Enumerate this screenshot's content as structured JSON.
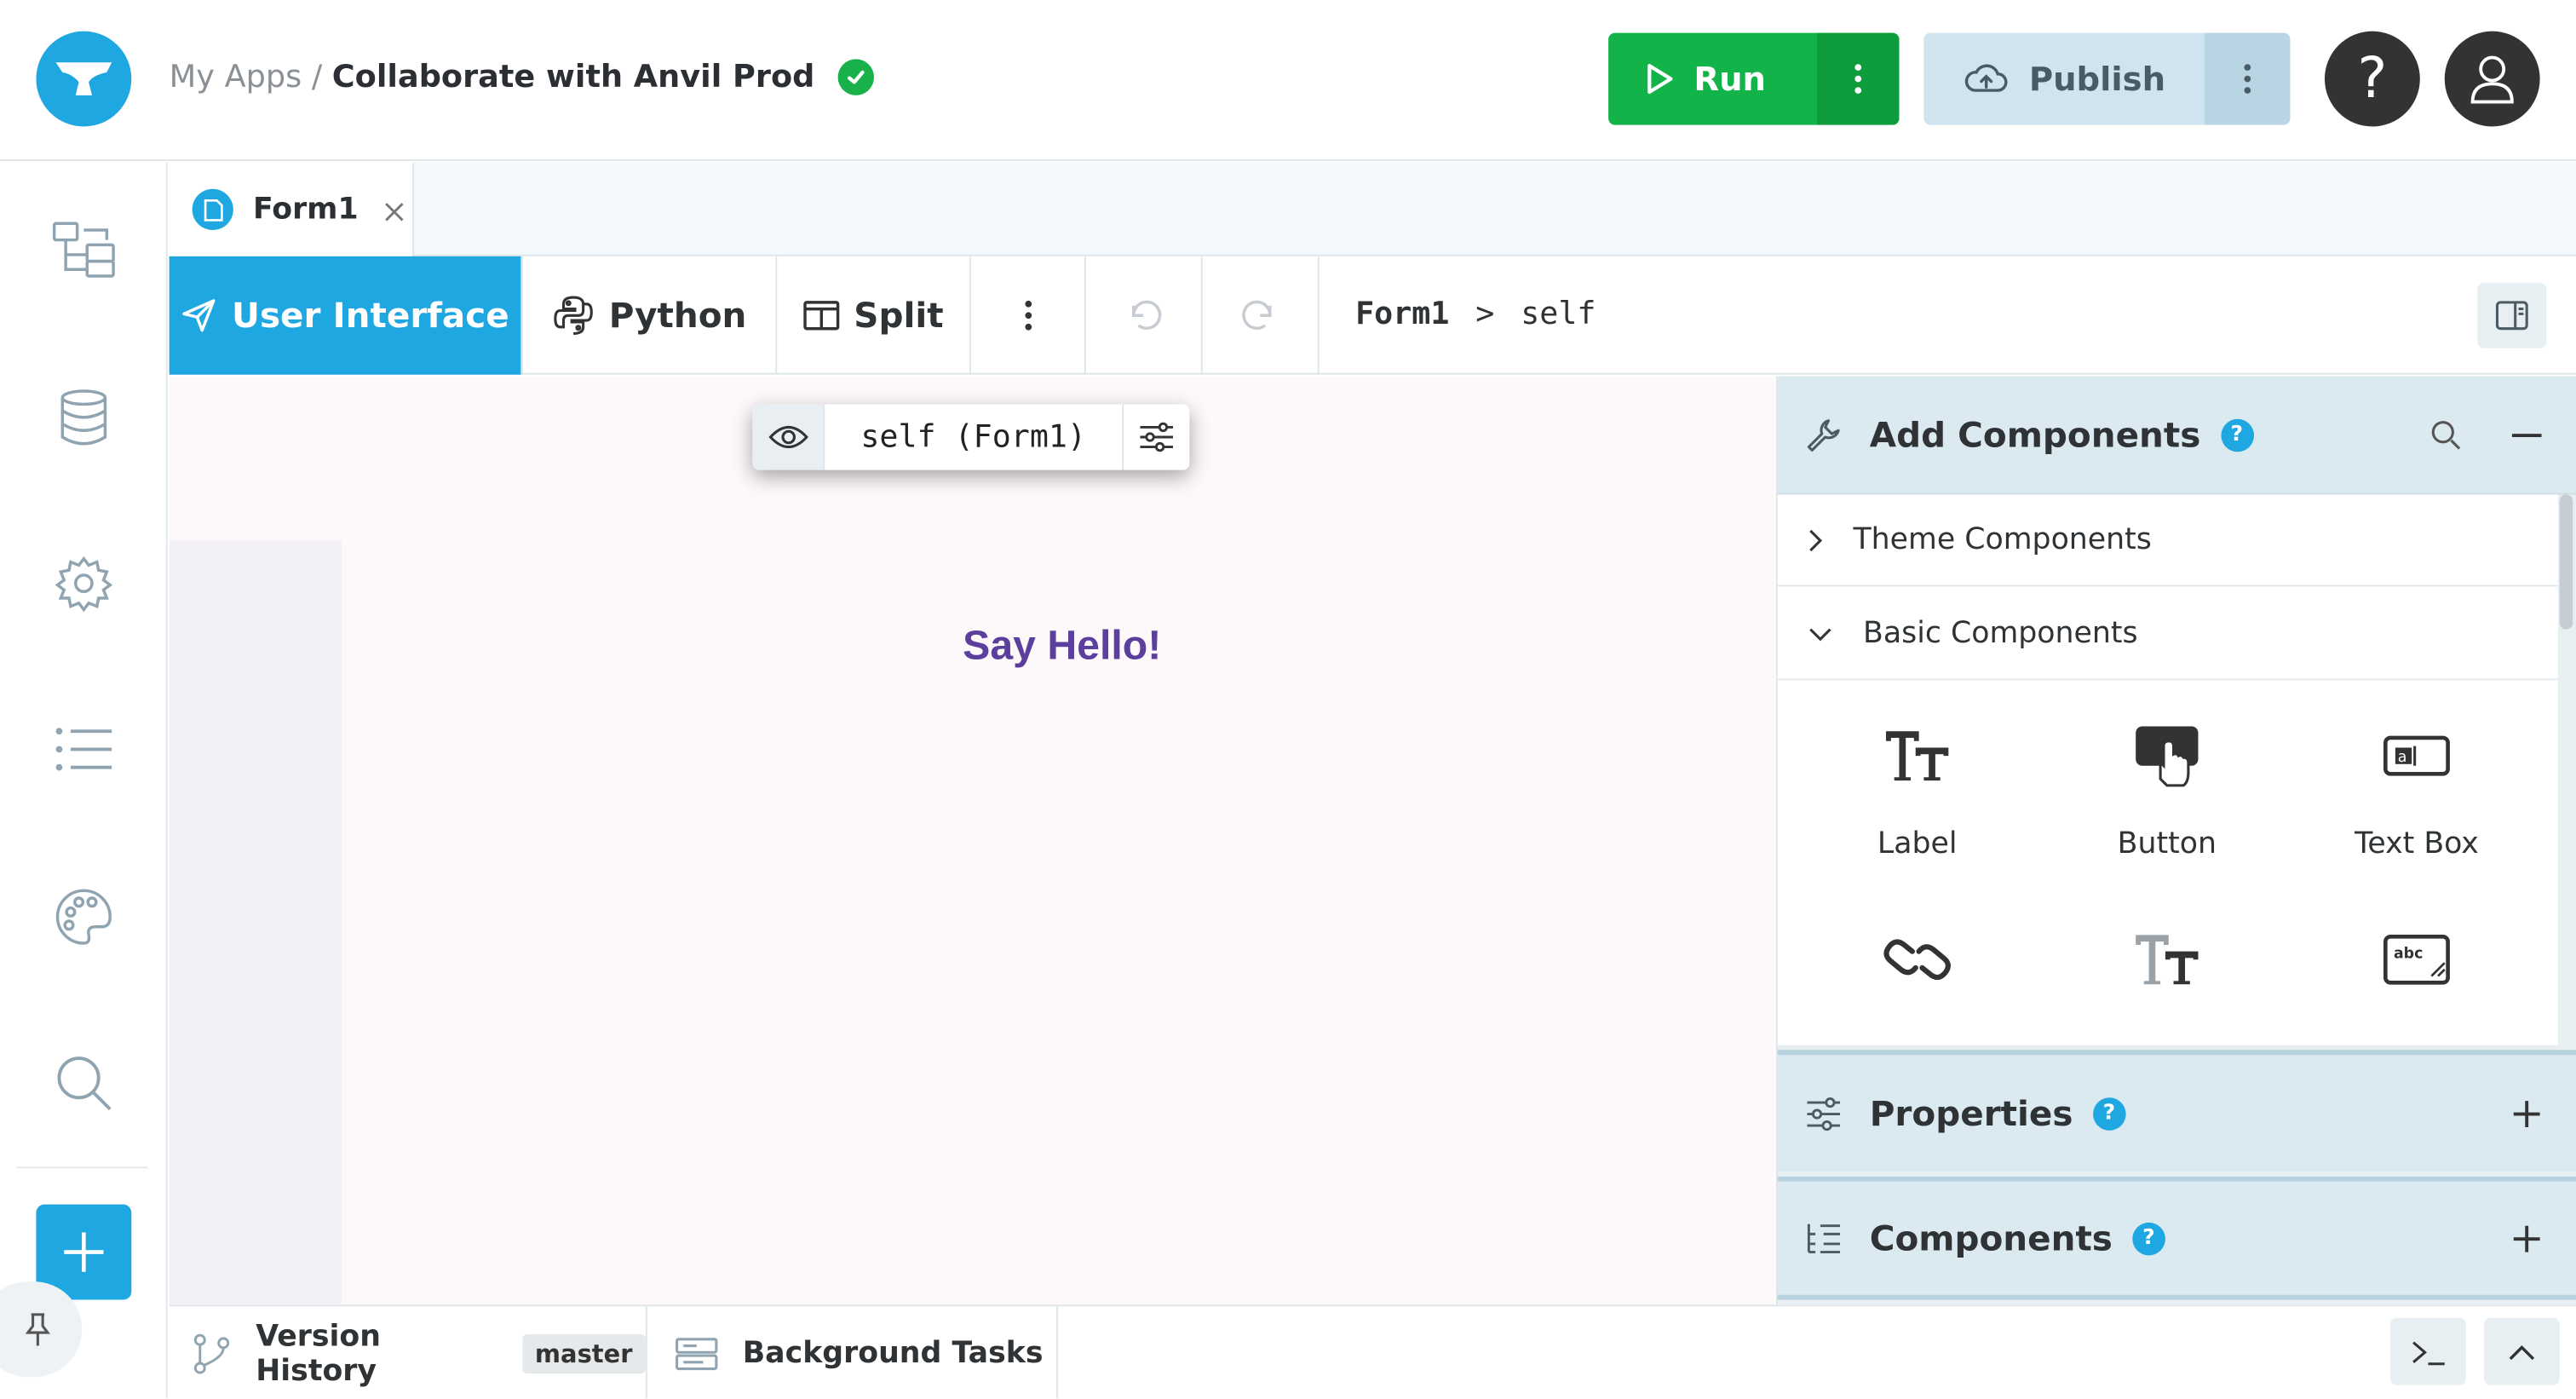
{
  "header": {
    "breadcrumb_root": "My Apps",
    "breadcrumb_sep": "/",
    "app_name": "Collaborate with Anvil Prod",
    "run_label": "Run",
    "publish_label": "Publish",
    "help_glyph": "?"
  },
  "tabs": [
    {
      "label": "Form1"
    }
  ],
  "toolbar": {
    "ui_label": "User Interface",
    "python_label": "Python",
    "split_label": "Split",
    "path_form": "Form1",
    "path_sep": ">",
    "path_self": "self"
  },
  "canvas": {
    "chip_label": "self (Form1)",
    "hello_text": "Say Hello!"
  },
  "panel": {
    "add_title": "Add Components",
    "theme_section": "Theme Components",
    "basic_section": "Basic Components",
    "components": [
      {
        "label": "Label",
        "icon": "label-icon"
      },
      {
        "label": "Button",
        "icon": "button-icon"
      },
      {
        "label": "Text Box",
        "icon": "textbox-icon"
      },
      {
        "label": "",
        "icon": "link-icon"
      },
      {
        "label": "",
        "icon": "rich-text-icon"
      },
      {
        "label": "",
        "icon": "text-area-icon"
      }
    ],
    "properties_title": "Properties",
    "components_title": "Components",
    "help_glyph": "?"
  },
  "footer": {
    "version_history": "Version History",
    "branch": "master",
    "background_tasks": "Background Tasks"
  },
  "colors": {
    "accent": "#1ea7e1",
    "run_green": "#12b449",
    "hello_purple": "#5c3f9c"
  }
}
